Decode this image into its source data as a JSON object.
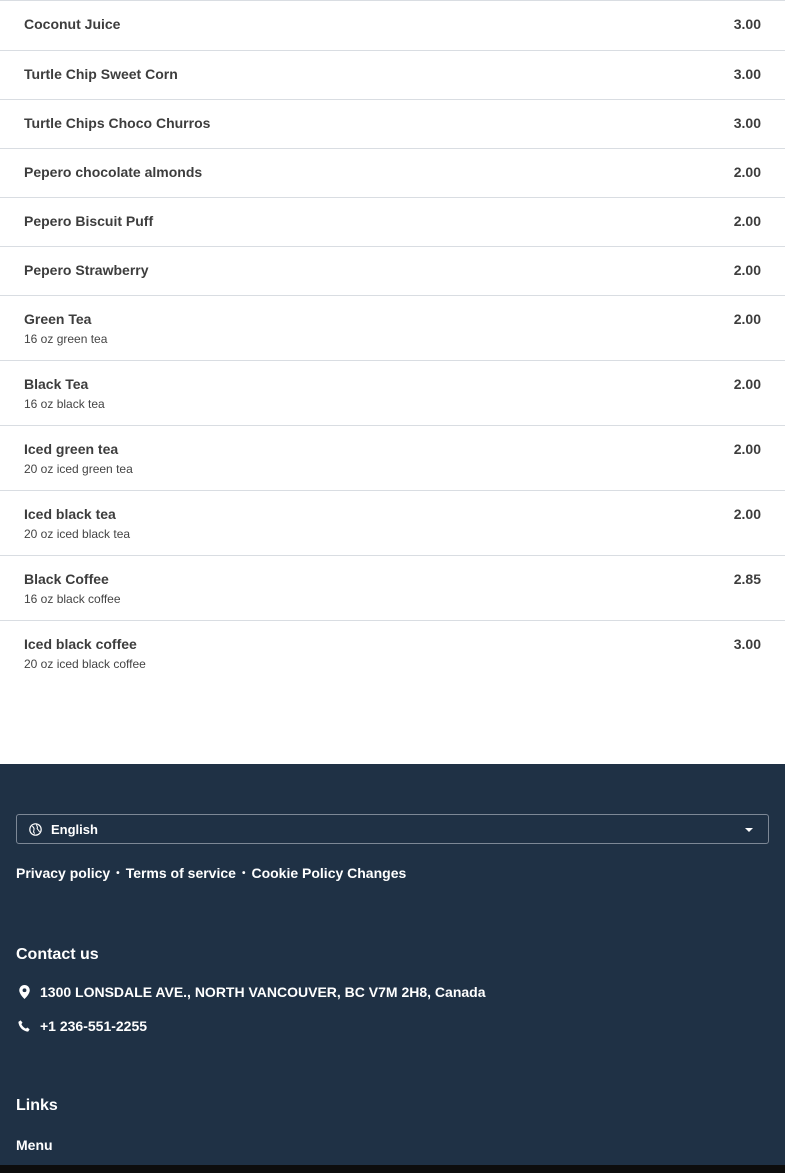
{
  "menu": {
    "items": [
      {
        "name": "Coconut Juice",
        "price": "3.00",
        "description": ""
      },
      {
        "name": "Turtle Chip Sweet Corn",
        "price": "3.00",
        "description": ""
      },
      {
        "name": "Turtle Chips Choco Churros",
        "price": "3.00",
        "description": ""
      },
      {
        "name": "Pepero chocolate almonds",
        "price": "2.00",
        "description": ""
      },
      {
        "name": "Pepero Biscuit Puff",
        "price": "2.00",
        "description": ""
      },
      {
        "name": "Pepero Strawberry",
        "price": "2.00",
        "description": ""
      },
      {
        "name": "Green Tea",
        "price": "2.00",
        "description": "16 oz green tea"
      },
      {
        "name": "Black Tea",
        "price": "2.00",
        "description": "16 oz black tea"
      },
      {
        "name": "Iced green tea",
        "price": "2.00",
        "description": "20 oz iced green tea"
      },
      {
        "name": "Iced black tea",
        "price": "2.00",
        "description": "20 oz iced black tea"
      },
      {
        "name": "Black Coffee",
        "price": "2.85",
        "description": "16 oz black coffee"
      },
      {
        "name": "Iced black coffee",
        "price": "3.00",
        "description": "20 oz iced black coffee"
      }
    ]
  },
  "footer": {
    "language": {
      "selected": "English",
      "icon": "globe-icon"
    },
    "policy_links": {
      "privacy": "Privacy policy",
      "terms": "Terms of service",
      "cookies": "Cookie Policy Changes",
      "separator": "•"
    },
    "contact": {
      "title": "Contact us",
      "address": "1300 LONSDALE AVE., NORTH VANCOUVER, BC V7M 2H8, Canada",
      "phone": "+1 236-551-2255"
    },
    "links": {
      "title": "Links",
      "menu": "Menu"
    }
  },
  "colors": {
    "footer_bg": "#1f3145",
    "divider": "#d9dde2",
    "text": "#3d3d3d"
  }
}
